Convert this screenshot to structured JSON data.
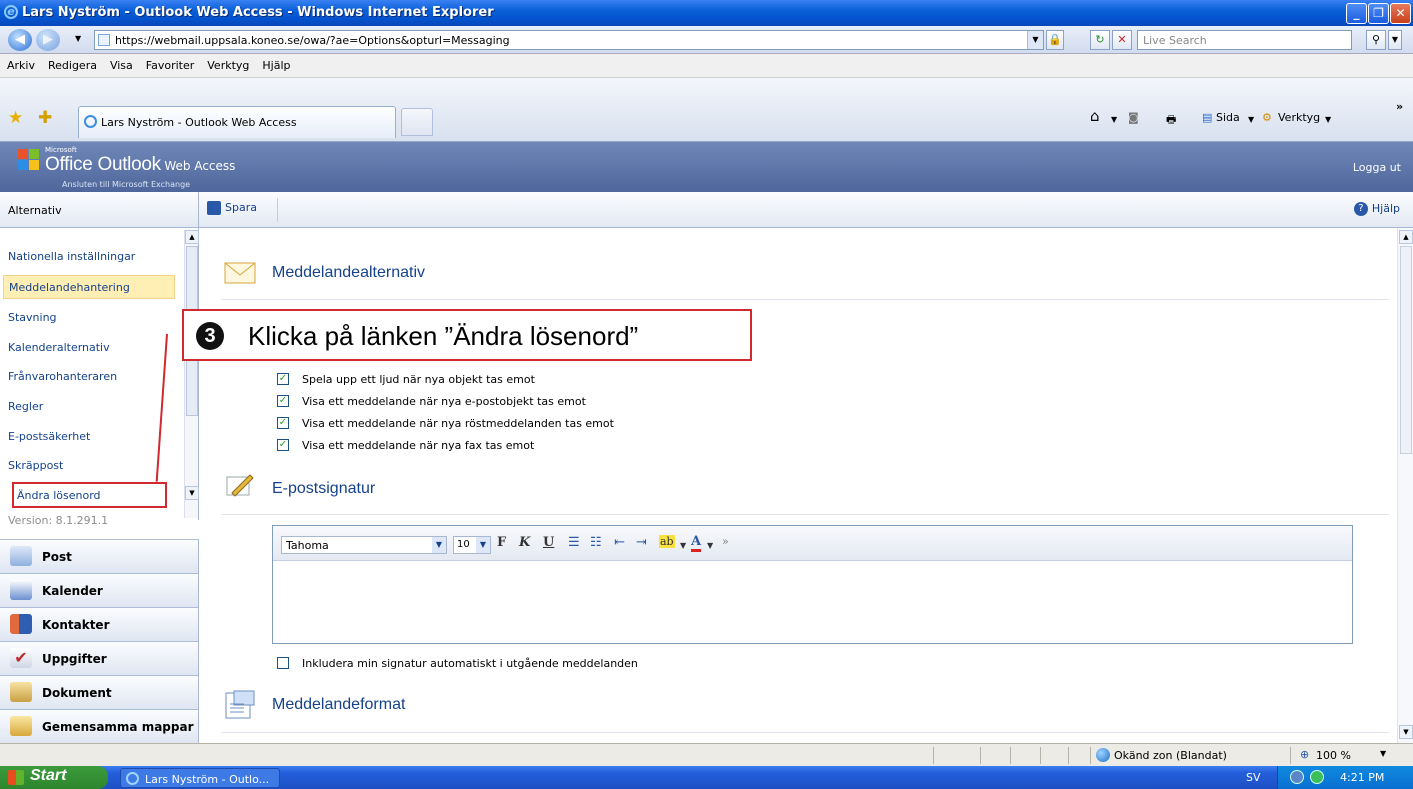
{
  "window": {
    "title": "Lars Nyström - Outlook Web Access - Windows Internet Explorer"
  },
  "address": {
    "url": "https://webmail.uppsala.koneo.se/owa/?ae=Options&opturl=Messaging",
    "search_placeholder": "Live Search"
  },
  "menu": [
    "Arkiv",
    "Redigera",
    "Visa",
    "Favoriter",
    "Verktyg",
    "Hjälp"
  ],
  "tabs": {
    "active_title": "Lars Nyström - Outlook Web Access"
  },
  "commandbar": {
    "page_label": "Sida",
    "tools_label": "Verktyg"
  },
  "owa": {
    "ms_label": "Microsoft",
    "product": "Office Outlook",
    "product_suffix": "Web Access",
    "subtitle": "Ansluten till Microsoft Exchange",
    "logout": "Logga ut"
  },
  "left": {
    "header": "Alternativ",
    "items": [
      {
        "label": "Nationella inställningar"
      },
      {
        "label": "Meddelandehantering"
      },
      {
        "label": "Stavning"
      },
      {
        "label": "Kalenderalternativ"
      },
      {
        "label": "Frånvarohanteraren"
      },
      {
        "label": "Regler"
      },
      {
        "label": "E-postsäkerhet"
      },
      {
        "label": "Skräppost"
      },
      {
        "label": "Ändra lösenord"
      }
    ],
    "version": "Version: 8.1.291.1",
    "nav": [
      {
        "label": "Post"
      },
      {
        "label": "Kalender"
      },
      {
        "label": "Kontakter"
      },
      {
        "label": "Uppgifter"
      },
      {
        "label": "Dokument"
      },
      {
        "label": "Gemensamma mappar"
      }
    ]
  },
  "toolbar": {
    "save": "Spara",
    "help": "Hjälp"
  },
  "sections": {
    "messaging": "Meddelandealternativ",
    "signature": "E-postsignatur",
    "format": "Meddelandeformat"
  },
  "notifications": [
    {
      "label": "Spela upp ett ljud när nya objekt tas emot",
      "checked": true
    },
    {
      "label": "Visa ett meddelande när nya e-postobjekt tas emot",
      "checked": true
    },
    {
      "label": "Visa ett meddelande när nya röstmeddelanden tas emot",
      "checked": true
    },
    {
      "label": "Visa ett meddelande när nya fax tas emot",
      "checked": true
    }
  ],
  "editor": {
    "font": "Tahoma",
    "size": "10",
    "bold": "F",
    "italic": "K",
    "underline": "U"
  },
  "signature_auto": {
    "label": "Inkludera min signatur automatiskt i utgående meddelanden",
    "checked": false
  },
  "callout": {
    "number": "3",
    "text": "Klicka på länken ”Ändra lösenord”"
  },
  "statusbar": {
    "zone": "Okänd zon (Blandat)",
    "zoom": "100 %"
  },
  "taskbar": {
    "start": "Start",
    "item": "Lars Nyström - Outlo...",
    "lang": "SV",
    "time": "4:21 PM"
  },
  "colors": {
    "owa_header": "#5a72a7",
    "link": "#15428b",
    "callout_border": "#d0292e",
    "selected_item": "#ffefb5"
  }
}
